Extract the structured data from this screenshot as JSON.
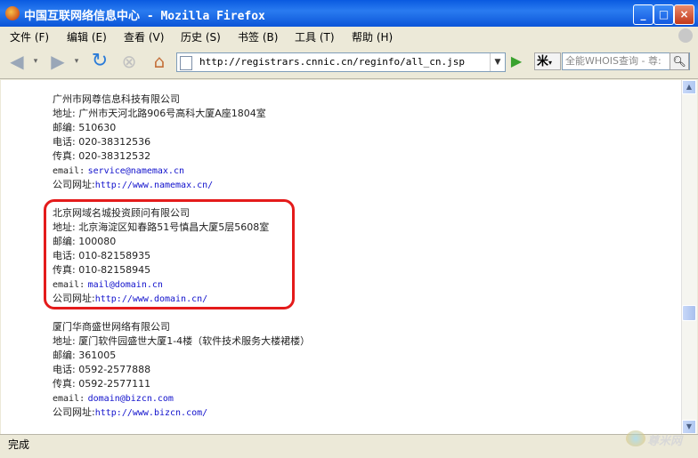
{
  "window": {
    "title": "中国互联网络信息中心 - Mozilla Firefox"
  },
  "menu": [
    {
      "label": "文件 (F)"
    },
    {
      "label": "编辑 (E)"
    },
    {
      "label": "查看 (V)"
    },
    {
      "label": "历史 (S)"
    },
    {
      "label": "书签 (B)"
    },
    {
      "label": "工具 (T)"
    },
    {
      "label": "帮助 (H)"
    }
  ],
  "navigation": {
    "url": "http://registrars.cnnic.cn/reginfo/all_cn.jsp",
    "search_placeholder": "全能WHOIS查询 - 尊:",
    "search_engine_logo": "米"
  },
  "companies": [
    {
      "name": "广州市网尊信息科技有限公司",
      "address": "地址: 广州市天河北路906号高科大厦A座1804室",
      "postcode": "邮编: 510630",
      "phone": "电话: 020-38312536",
      "fax": "传真: 020-38312532",
      "email_label": "email:",
      "email": "service@namemax.cn",
      "site_label": "公司网址:",
      "site": "http://www.namemax.cn/"
    },
    {
      "name": "北京网域名城投资顾问有限公司",
      "address": "地址: 北京海淀区知春路51号慎昌大厦5层5608室",
      "postcode": "邮编: 100080",
      "phone": "电话: 010-82158935",
      "fax": "传真: 010-82158945",
      "email_label": "email:",
      "email": "mail@domain.cn",
      "site_label": "公司网址:",
      "site": "http://www.domain.cn/"
    },
    {
      "name": "厦门华商盛世网络有限公司",
      "address": "地址: 厦门软件园盛世大厦1-4楼（软件技术服务大楼裙楼）",
      "postcode": "邮编: 361005",
      "phone": "电话: 0592-2577888",
      "fax": "传真: 0592-2577111",
      "email_label": "email:",
      "email": "domain@bizcn.com",
      "site_label": "公司网址:",
      "site": "http://www.bizcn.com/"
    }
  ],
  "status": {
    "text": "完成"
  },
  "watermark": {
    "text": "尊米网"
  },
  "colors": {
    "highlight": "#e41b1b",
    "link": "#1111cc",
    "titlebar": "#0a5ae0"
  }
}
